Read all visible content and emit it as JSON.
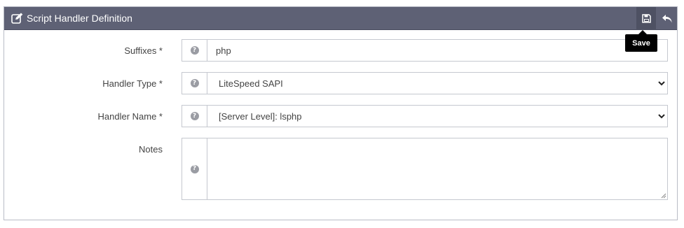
{
  "panel": {
    "title": "Script Handler Definition",
    "title_icon": "edit-icon",
    "toolbar": {
      "save_icon": "save-icon",
      "back_icon": "undo-icon",
      "save_tooltip": "Save"
    }
  },
  "form": {
    "help_glyph": "?",
    "suffixes": {
      "label": "Suffixes *",
      "value": "php"
    },
    "handler_type": {
      "label": "Handler Type *",
      "value": "LiteSpeed SAPI"
    },
    "handler_name": {
      "label": "Handler Name *",
      "value": "[Server Level]: lsphp"
    },
    "notes": {
      "label": "Notes",
      "value": ""
    }
  },
  "colors": {
    "header_bg": "#5e6175",
    "panel_border": "#b9bcc6",
    "tooltip_bg": "#000000"
  }
}
